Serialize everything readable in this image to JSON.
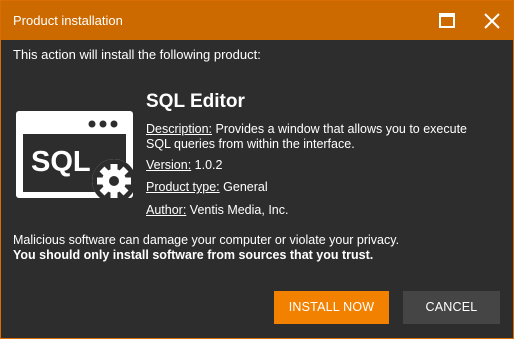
{
  "window": {
    "title": "Product installation",
    "maximize_icon": "maximize-icon",
    "close_icon": "close-icon"
  },
  "intro": "This action will install the following product:",
  "product": {
    "icon": "sql-editor-icon",
    "icon_text": "SQL",
    "name": "SQL Editor",
    "description_label": "Description:",
    "description_line1": "Provides a window that allows you to execute",
    "description_line2": "SQL queries from within the interface.",
    "version_label": "Version:",
    "version": "1.0.2",
    "type_label": "Product type:",
    "type": "General",
    "author_label": "Author:",
    "author": "Ventis Media, Inc."
  },
  "warning": {
    "line1": "Malicious software can damage your computer or violate your privacy.",
    "line2": "You should only install software from sources that you trust."
  },
  "buttons": {
    "install": "INSTALL NOW",
    "cancel": "CANCEL"
  },
  "colors": {
    "titlebar": "#cc6a00",
    "accent": "#f28100",
    "background": "#2d2d2d",
    "secondary_button": "#454545"
  }
}
